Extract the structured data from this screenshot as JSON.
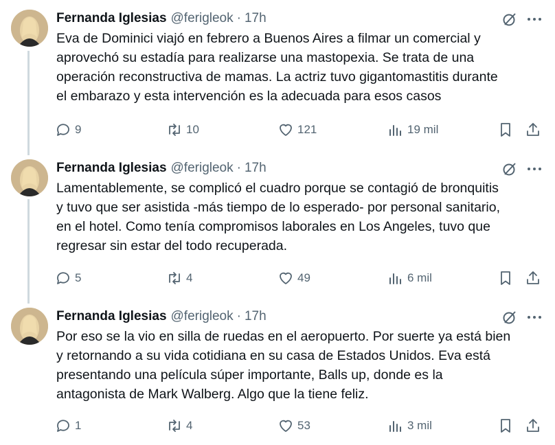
{
  "tweets": [
    {
      "author": "Fernanda Iglesias",
      "handle": "@ferigleok",
      "separator": "·",
      "time": "17h",
      "text": "Eva de Dominici viajó en febrero a Buenos Aires a filmar un comercial y\naprovechó su estadía para realizarse una mastopexia. Se trata de una\noperación reconstructiva de mamas. La actriz tuvo gigantomastitis durante\nel embarazo y esta intervención es la adecuada para esos casos",
      "replies": "9",
      "reposts": "10",
      "likes": "121",
      "views": "19 mil"
    },
    {
      "author": "Fernanda Iglesias",
      "handle": "@ferigleok",
      "separator": "·",
      "time": "17h",
      "text": "Lamentablemente, se complicó el cuadro porque se contagió de bronquitis\ny tuvo que ser asistida -más tiempo de lo esperado- por personal sanitario,\nen el hotel. Como tenía compromisos laborales en Los Angeles, tuvo que\nregresar sin estar del todo recuperada.",
      "replies": "5",
      "reposts": "4",
      "likes": "49",
      "views": "6 mil"
    },
    {
      "author": "Fernanda Iglesias",
      "handle": "@ferigleok",
      "separator": "·",
      "time": "17h",
      "text": "Por eso se la vio en silla de ruedas en el aeropuerto. Por suerte ya está bien\ny retornando a su vida cotidiana en su casa de Estados Unidos. Eva está\npresentando una película súper importante, Balls up, donde es la\nantagonista de Mark Walberg. Algo que la tiene feliz.",
      "replies": "1",
      "reposts": "4",
      "likes": "53",
      "views": "3 mil"
    }
  ],
  "icons": {
    "reply": "reply-icon",
    "repost": "repost-icon",
    "like": "heart-icon",
    "views": "views-icon",
    "bookmark": "bookmark-icon",
    "share": "share-icon",
    "grok": "grok-icon",
    "more": "more-icon"
  },
  "colors": {
    "text": "#0f1419",
    "secondary": "#536471",
    "thread_line": "#cfd9de",
    "background": "#ffffff"
  }
}
